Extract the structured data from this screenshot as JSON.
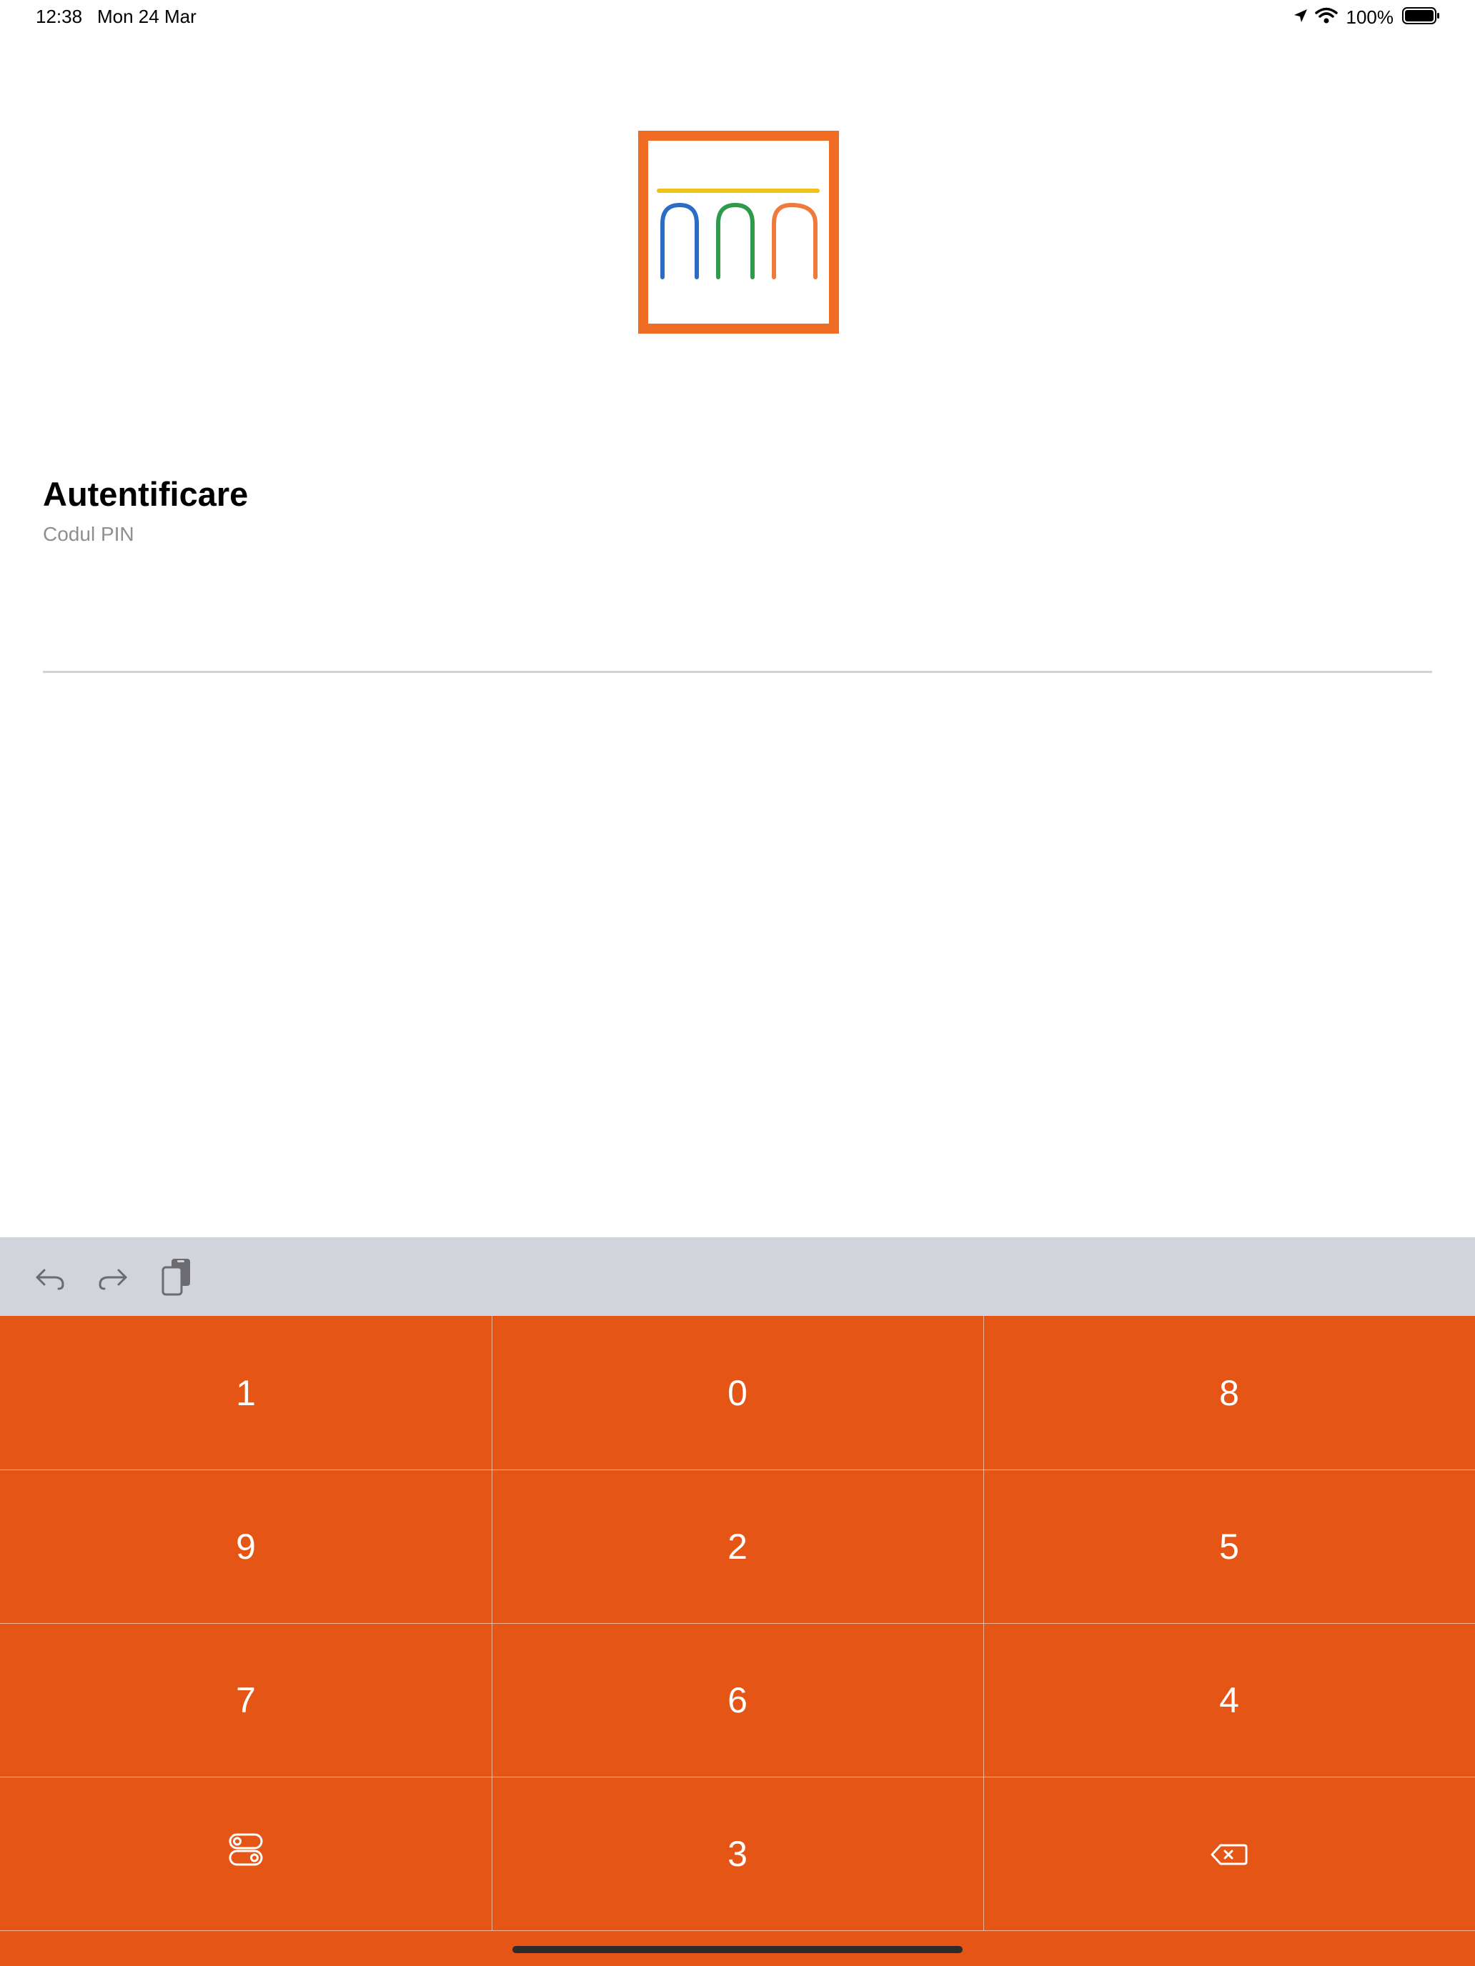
{
  "status_bar": {
    "time": "12:38",
    "date": "Mon 24 Mar",
    "battery_percent": "100%",
    "icons": [
      "location-arrow-icon",
      "wifi-icon",
      "battery-icon"
    ]
  },
  "logo": {
    "name": "bank-logo",
    "colors": {
      "frame": "#f06b24",
      "bar": "#f2c21b",
      "arch_blue": "#2b6cc4",
      "arch_green": "#2e9a4a",
      "arch_orange": "#f07a3a"
    }
  },
  "login": {
    "title": "Autentificare",
    "pin_label": "Codul PIN",
    "pin_value": ""
  },
  "shortcut_bar": {
    "icons": [
      "undo-icon",
      "redo-icon",
      "paste-icon"
    ]
  },
  "keypad": {
    "accent_color": "#e55515",
    "rows": [
      [
        "1",
        "0",
        "8"
      ],
      [
        "9",
        "2",
        "5"
      ],
      [
        "7",
        "6",
        "4"
      ],
      [
        "switch-toggle-icon",
        "3",
        "delete-backspace-icon"
      ]
    ],
    "keys": {
      "r0c0": "1",
      "r0c1": "0",
      "r0c2": "8",
      "r1c0": "9",
      "r1c1": "2",
      "r1c2": "5",
      "r2c0": "7",
      "r2c1": "6",
      "r2c2": "4",
      "r3c1": "3"
    }
  }
}
